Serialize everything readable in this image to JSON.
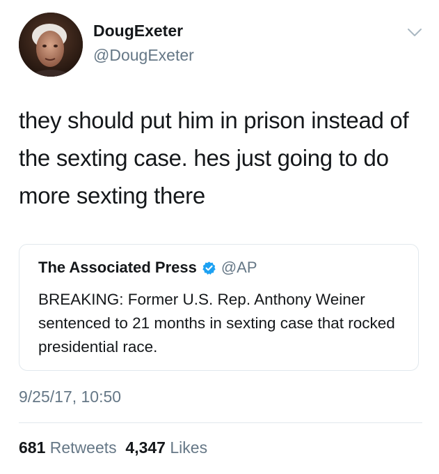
{
  "author": {
    "display_name": "DougExeter",
    "handle": "@DougExeter"
  },
  "tweet": {
    "text": "they should put him in prison instead of the sexting case. hes just going to do more sexting there"
  },
  "quoted_tweet": {
    "name": "The Associated Press",
    "handle": "@AP",
    "verified": true,
    "text": "BREAKING: Former U.S. Rep. Anthony Weiner sentenced to 21 months in sexting case that rocked presidential race."
  },
  "timestamp": "9/25/17, 10:50",
  "stats": {
    "retweets_count": "681",
    "retweets_label": "Retweets",
    "likes_count": "4,347",
    "likes_label": "Likes"
  },
  "icons": {
    "caret": "chevron-down-icon",
    "verified": "verified-badge-icon"
  },
  "colors": {
    "text_primary": "#14171a",
    "text_secondary": "#657786",
    "border": "#e1e8ed",
    "verified_blue": "#1da1f2"
  }
}
